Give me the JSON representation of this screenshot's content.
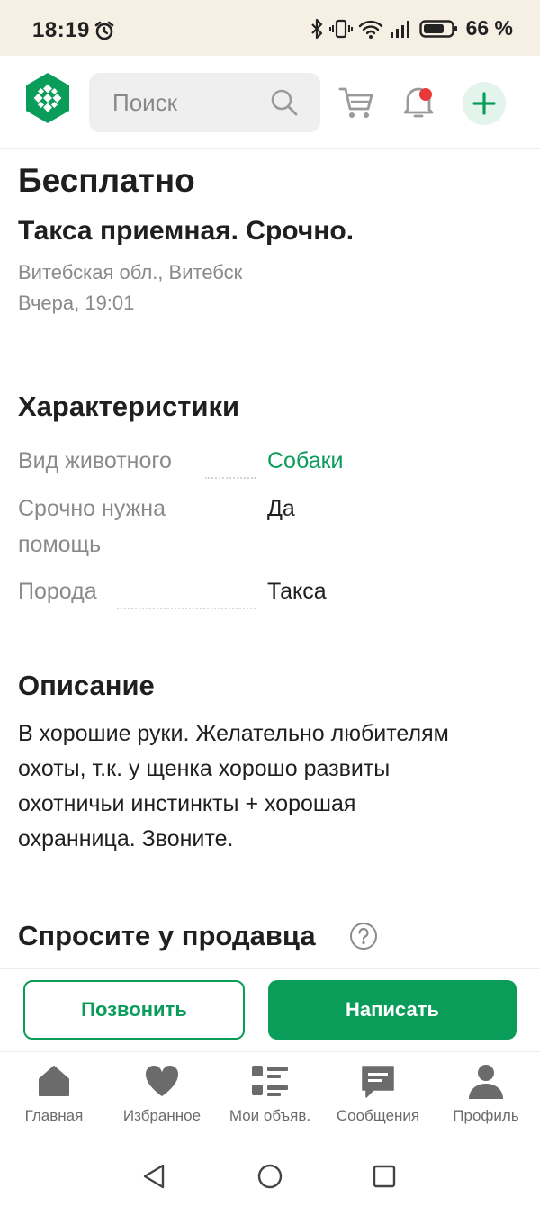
{
  "status_bar": {
    "time": "18:19",
    "battery": "66 %",
    "icons": [
      "alarm-icon",
      "bluetooth-icon",
      "vibrate-icon",
      "wifi-icon",
      "signal-icon",
      "battery-icon"
    ]
  },
  "header": {
    "search_placeholder": "Поиск",
    "icons": [
      "logo-icon",
      "search-icon",
      "cart-icon",
      "bell-icon",
      "plus-icon"
    ],
    "notification_dot_color": "#e8393a"
  },
  "listing": {
    "price": "Бесплатно",
    "title": "Такса приемная. Срочно.",
    "location": "Витебская обл., Витебск",
    "date": "Вчера, 19:01"
  },
  "characteristics": {
    "heading": "Характеристики",
    "rows": [
      {
        "label": "Вид животного",
        "value": "Собаки"
      },
      {
        "label_line1": "Срочно нужна",
        "label_line2": "помощь",
        "value": "Да"
      },
      {
        "label": "Порода",
        "value": "Такса"
      }
    ]
  },
  "description": {
    "heading": "Описание",
    "lines": [
      "В хорошие руки. Желательно любителям",
      "охоты, т.к. у щенка хорошо развиты",
      "охотничьи инстинкты + хорошая",
      "охранница. Звоните."
    ]
  },
  "ask_seller": {
    "heading": "Спросите у продавца"
  },
  "actions": {
    "call_label": "Позвонить",
    "write_label": "Написать"
  },
  "bottom_nav": {
    "items": [
      {
        "label": "Главная",
        "icon": "home-icon"
      },
      {
        "label": "Избранное",
        "icon": "heart-icon"
      },
      {
        "label": "Мои объяв.",
        "icon": "list-icon"
      },
      {
        "label": "Сообщения",
        "icon": "chat-icon"
      },
      {
        "label": "Профиль",
        "icon": "profile-icon"
      }
    ]
  },
  "system_nav": {
    "icons": [
      "back-icon",
      "home-circle-icon",
      "recents-icon"
    ]
  },
  "colors": {
    "accent": "#0a9d5a",
    "status_bar_bg": "#f6f0e4",
    "muted_text": "#8a8a8a"
  }
}
